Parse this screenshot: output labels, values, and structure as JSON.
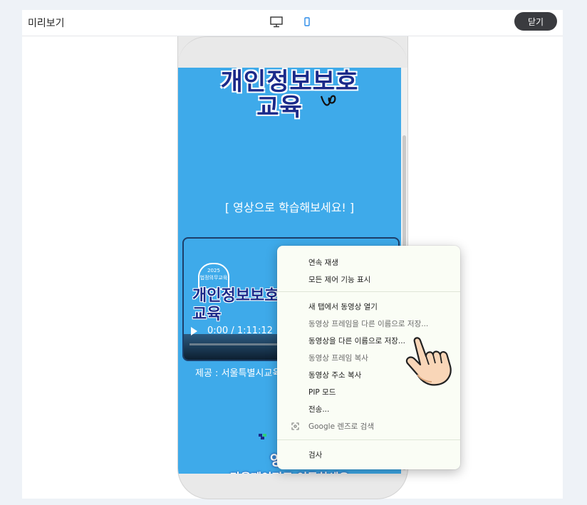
{
  "header": {
    "title": "미리보기",
    "close_label": "닫기",
    "devices": [
      "desktop-icon",
      "mobile-icon"
    ],
    "active_device": "mobile"
  },
  "page": {
    "banner_line1": "개인정보보호",
    "banner_line2": "교육",
    "subtitle": "[ 영상으로 학습해보세요! ]",
    "video": {
      "badge_year": "2025",
      "badge_text": "법정의무교육",
      "title_line1": "개인정보보호",
      "title_line2": "교육",
      "time": "0:00 / 1:11:12"
    },
    "provider": "제공 : 서울특별시교육",
    "bottom_line1": "영상을",
    "bottom_line2": "다음페이지로 이동하세요"
  },
  "context_menu": {
    "items": [
      {
        "label": "연속 재생",
        "enabled": true
      },
      {
        "label": "모든 제어 기능 표시",
        "enabled": true
      },
      {
        "label": "새 탭에서 동영상 열기",
        "enabled": true
      },
      {
        "label": "동영상 프레임을 다른 이름으로 저장...",
        "enabled": false
      },
      {
        "label": "동영상을 다른 이름으로 저장...",
        "enabled": true
      },
      {
        "label": "동영상 프레임 복사",
        "enabled": false
      },
      {
        "label": "동영상 주소 복사",
        "enabled": true
      },
      {
        "label": "PIP 모드",
        "enabled": true
      },
      {
        "label": "전송...",
        "enabled": true
      },
      {
        "label": "Google 렌즈로 검색",
        "enabled": false
      },
      {
        "label": "검사",
        "enabled": true
      }
    ]
  },
  "colors": {
    "page_bg": "#3eaaea",
    "banner_text": "#1b2a8a",
    "active_device": "#2b8be8",
    "close_button": "#3a3b3f"
  }
}
